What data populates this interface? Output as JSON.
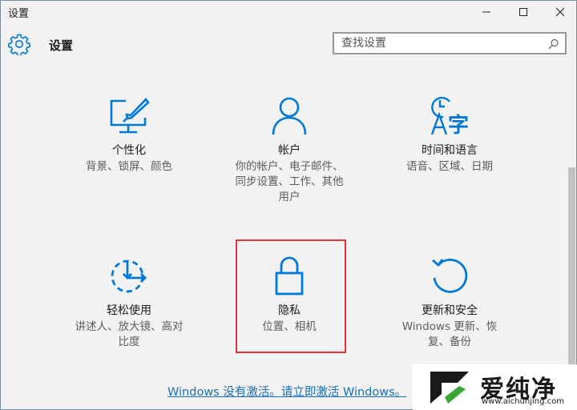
{
  "window": {
    "title": "设置"
  },
  "header": {
    "title": "设置"
  },
  "search": {
    "placeholder": "查找设置"
  },
  "tiles": [
    {
      "title": "个性化",
      "desc": [
        "背景、锁屏、颜色"
      ]
    },
    {
      "title": "帐户",
      "desc": [
        "你的帐户、电子邮件、",
        "同步设置、工作、其他",
        "用户"
      ]
    },
    {
      "title": "时间和语言",
      "desc": [
        "语音、区域、日期"
      ]
    },
    {
      "title": "轻松使用",
      "desc": [
        "讲述人、放大镜、高对",
        "比度"
      ]
    },
    {
      "title": "隐私",
      "desc": [
        "位置、相机"
      ]
    },
    {
      "title": "更新和安全",
      "desc": [
        "Windows 更新、恢",
        "复、备份"
      ]
    }
  ],
  "activation": {
    "link": "Windows 没有激活。请立即激活 Windows。"
  },
  "watermark": {
    "name": "爱纯净",
    "url": "www.aichunjing.com"
  },
  "colors": {
    "accent": "#0078d7",
    "highlight": "#e0353a",
    "link": "#1a6fb9"
  }
}
